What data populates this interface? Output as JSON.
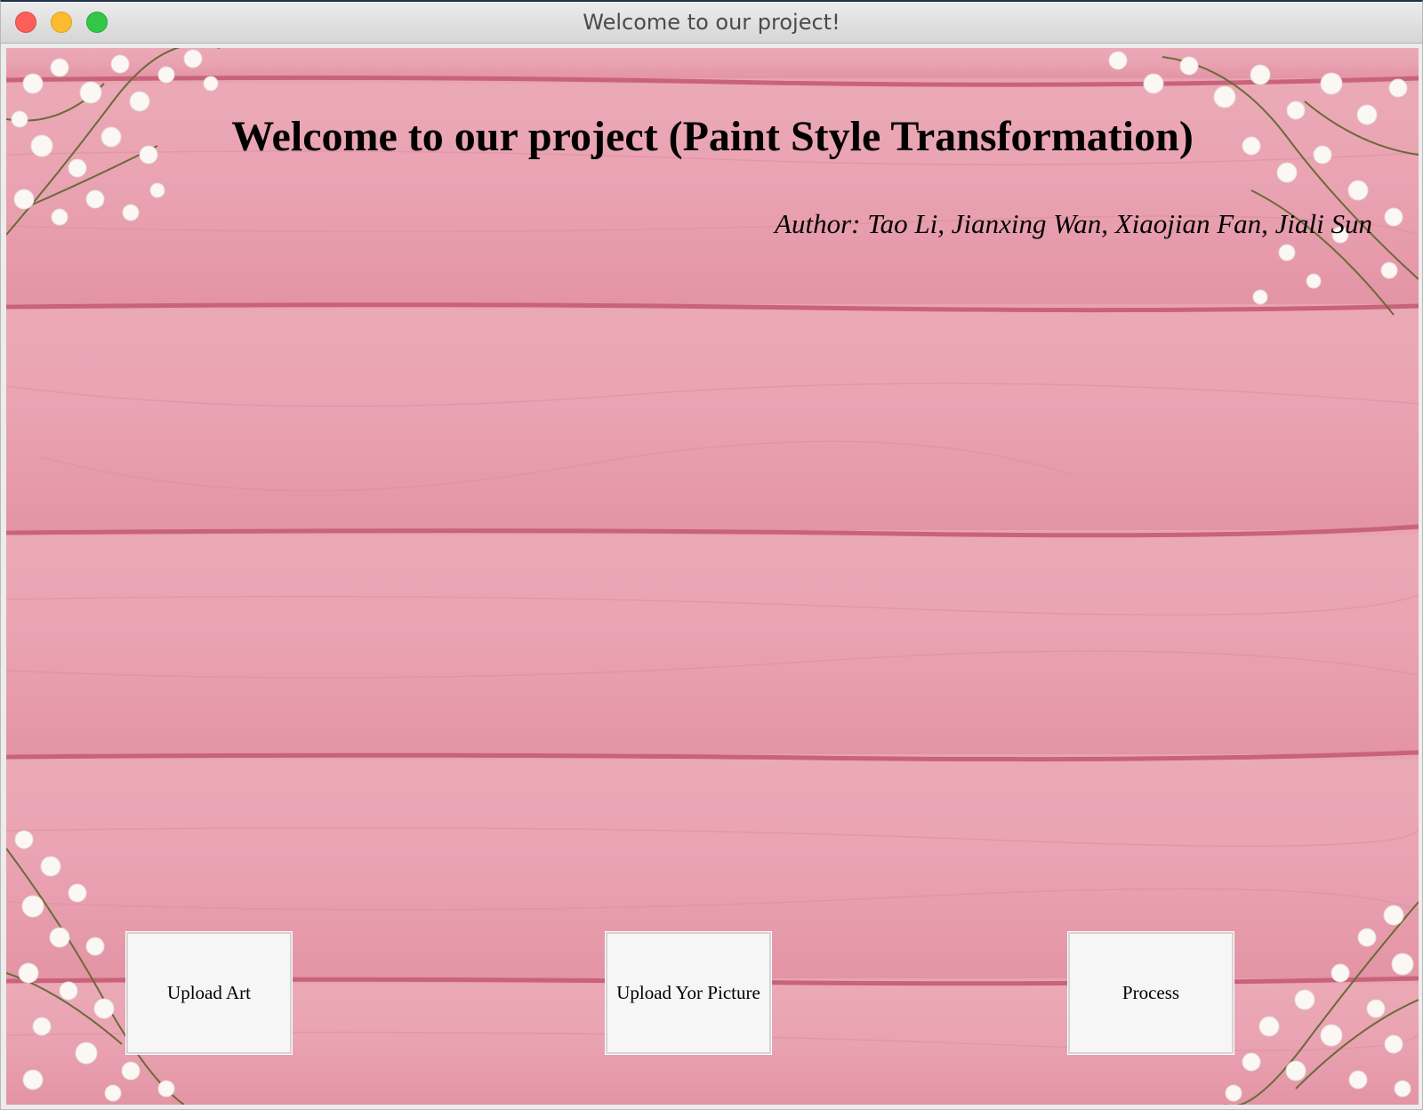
{
  "window": {
    "title": "Welcome to our project!",
    "controls": [
      "close",
      "minimize",
      "maximize"
    ]
  },
  "main": {
    "heading": "Welcome to our project (Paint Style Transformation)",
    "author": "Author: Tao Li, Jianxing Wan, Xiaojian Fan, Jiali Sun",
    "background": "pink wooden planks with white baby's breath flowers"
  },
  "buttons": {
    "upload_art": "Upload Art",
    "upload_picture": "Upload Yor Picture",
    "process": "Process"
  },
  "colors": {
    "plank_pink": "#e8a4b2",
    "plank_seam": "#c8607a",
    "button_bg": "#f6f6f6"
  }
}
